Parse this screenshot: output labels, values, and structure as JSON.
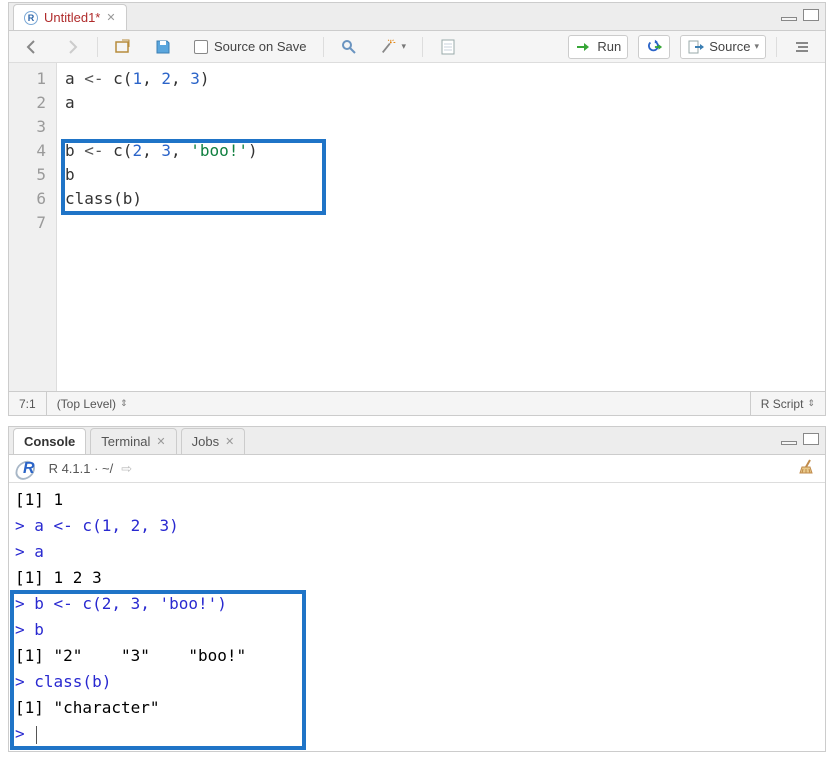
{
  "source": {
    "tab_title": "Untitled1*",
    "toolbar": {
      "source_on_save": "Source on Save",
      "run": "Run",
      "source": "Source"
    },
    "code_lines": [
      "a <- c(1, 2, 3)",
      "a",
      "",
      "b <- c(2, 3, 'boo!')",
      "b",
      "class(b)",
      ""
    ],
    "gutter": [
      "1",
      "2",
      "3",
      "4",
      "5",
      "6",
      "7"
    ],
    "status": {
      "cursor": "7:1",
      "scope": "(Top Level)",
      "filetype": "R Script"
    }
  },
  "console": {
    "tabs": {
      "console": "Console",
      "terminal": "Terminal",
      "jobs": "Jobs"
    },
    "header": "R 4.1.1 · ~/",
    "lines": [
      {
        "t": "out",
        "text": "[1] 1"
      },
      {
        "t": "input",
        "text": "> a <- c(1, 2, 3)"
      },
      {
        "t": "input",
        "text": "> a"
      },
      {
        "t": "out",
        "text": "[1] 1 2 3"
      },
      {
        "t": "input",
        "text": "> b <- c(2, 3, 'boo!')"
      },
      {
        "t": "input",
        "text": "> b"
      },
      {
        "t": "out",
        "text": "[1] \"2\"    \"3\"    \"boo!\""
      },
      {
        "t": "input",
        "text": "> class(b)"
      },
      {
        "t": "out",
        "text": "[1] \"character\""
      },
      {
        "t": "input",
        "text": "> "
      }
    ]
  },
  "icons": {
    "r_badge": "R"
  }
}
